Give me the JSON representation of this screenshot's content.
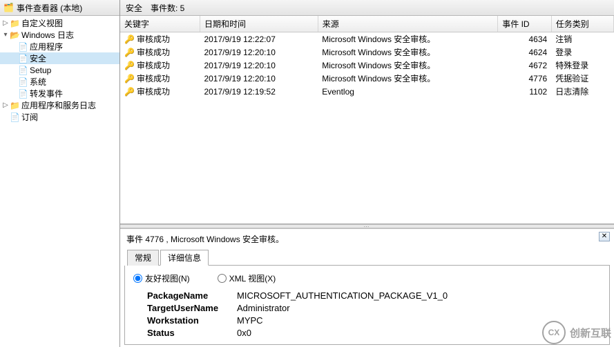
{
  "sidebar": {
    "header": "事件查看器 (本地)",
    "items": [
      {
        "label": "自定义视图",
        "icon": "📁",
        "exp": "▷",
        "indent": 0
      },
      {
        "label": "Windows 日志",
        "icon": "📂",
        "exp": "▾",
        "indent": 0
      },
      {
        "label": "应用程序",
        "icon": "📄",
        "exp": "",
        "indent": 1
      },
      {
        "label": "安全",
        "icon": "📄",
        "exp": "",
        "indent": 1,
        "selected": true
      },
      {
        "label": "Setup",
        "icon": "📄",
        "exp": "",
        "indent": 1
      },
      {
        "label": "系统",
        "icon": "📄",
        "exp": "",
        "indent": 1
      },
      {
        "label": "转发事件",
        "icon": "📄",
        "exp": "",
        "indent": 1
      },
      {
        "label": "应用程序和服务日志",
        "icon": "📁",
        "exp": "▷",
        "indent": 0
      },
      {
        "label": "订阅",
        "icon": "📄",
        "exp": "",
        "indent": 0
      }
    ]
  },
  "content_header": {
    "title": "安全",
    "count_label": "事件数: 5"
  },
  "table": {
    "columns": [
      "关键字",
      "日期和时间",
      "来源",
      "事件 ID",
      "任务类别"
    ],
    "rows": [
      {
        "keyword": "审核成功",
        "datetime": "2017/9/19 12:22:07",
        "source": "Microsoft Windows 安全审核。",
        "id": "4634",
        "task": "注销"
      },
      {
        "keyword": "审核成功",
        "datetime": "2017/9/19 12:20:10",
        "source": "Microsoft Windows 安全审核。",
        "id": "4624",
        "task": "登录"
      },
      {
        "keyword": "审核成功",
        "datetime": "2017/9/19 12:20:10",
        "source": "Microsoft Windows 安全审核。",
        "id": "4672",
        "task": "特殊登录"
      },
      {
        "keyword": "审核成功",
        "datetime": "2017/9/19 12:20:10",
        "source": "Microsoft Windows 安全审核。",
        "id": "4776",
        "task": "凭据验证"
      },
      {
        "keyword": "审核成功",
        "datetime": "2017/9/19 12:19:52",
        "source": "Eventlog",
        "id": "1102",
        "task": "日志清除"
      }
    ]
  },
  "detail": {
    "title": "事件 4776 , Microsoft Windows 安全审核。",
    "tabs": {
      "general": "常规",
      "details": "详细信息"
    },
    "view": {
      "friendly": "友好视图(N)",
      "xml": "XML 视图(X)"
    },
    "fields": [
      {
        "key": "PackageName",
        "value": "MICROSOFT_AUTHENTICATION_PACKAGE_V1_0"
      },
      {
        "key": "TargetUserName",
        "value": "Administrator"
      },
      {
        "key": "Workstation",
        "value": "MYPC"
      },
      {
        "key": "Status",
        "value": "0x0"
      }
    ]
  },
  "watermark": {
    "logo": "CX",
    "text": "创新互联"
  }
}
